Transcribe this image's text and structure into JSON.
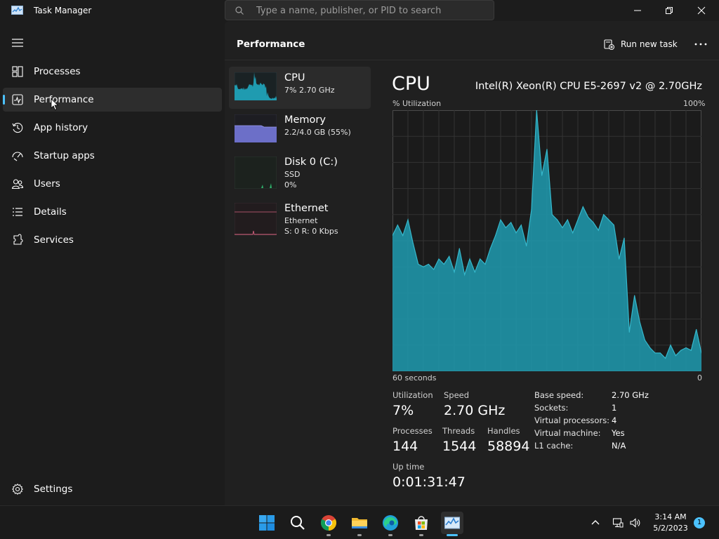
{
  "window": {
    "title": "Task Manager",
    "search_placeholder": "Type a name, publisher, or PID to search"
  },
  "sidebar": {
    "items": [
      {
        "label": "Processes",
        "icon": "processes-grid-icon"
      },
      {
        "label": "Performance",
        "icon": "performance-pulse-icon",
        "active": true
      },
      {
        "label": "App history",
        "icon": "history-clock-icon"
      },
      {
        "label": "Startup apps",
        "icon": "startup-gauge-icon"
      },
      {
        "label": "Users",
        "icon": "users-icon"
      },
      {
        "label": "Details",
        "icon": "details-list-icon"
      },
      {
        "label": "Services",
        "icon": "services-puzzle-icon"
      }
    ],
    "settings_label": "Settings"
  },
  "header": {
    "title": "Performance",
    "run_task_label": "Run new task"
  },
  "devices": [
    {
      "name": "CPU",
      "line1": "7%  2.70 GHz",
      "line2": "",
      "color": "#1f9bb0"
    },
    {
      "name": "Memory",
      "line1": "2.2/4.0 GB (55%)",
      "line2": "",
      "color": "#7b7fd6"
    },
    {
      "name": "Disk 0 (C:)",
      "line1": "SSD",
      "line2": "0%",
      "color": "#2fb06b"
    },
    {
      "name": "Ethernet",
      "line1": "Ethernet",
      "line2": "S: 0  R: 0 Kbps",
      "color": "#d4607e"
    }
  ],
  "detail": {
    "title": "CPU",
    "model": "Intel(R) Xeon(R) CPU E5-2697 v2 @ 2.70GHz",
    "y_label": "% Utilization",
    "y_max_label": "100%",
    "x_left_label": "60 seconds",
    "x_right_label": "0",
    "stats": {
      "utilization_label": "Utilization",
      "utilization": "7%",
      "speed_label": "Speed",
      "speed": "2.70 GHz",
      "processes_label": "Processes",
      "processes": "144",
      "threads_label": "Threads",
      "threads": "1544",
      "handles_label": "Handles",
      "handles": "58894",
      "uptime_label": "Up time",
      "uptime": "0:01:31:47"
    },
    "specs": [
      {
        "label": "Base speed:",
        "value": "2.70 GHz"
      },
      {
        "label": "Sockets:",
        "value": "1"
      },
      {
        "label": "Virtual processors:",
        "value": "4"
      },
      {
        "label": "Virtual machine:",
        "value": "Yes"
      },
      {
        "label": "L1 cache:",
        "value": "N/A"
      }
    ]
  },
  "chart_data": {
    "type": "area",
    "x_seconds_ago": [
      60,
      59,
      58,
      57,
      56,
      55,
      54,
      53,
      52,
      51,
      50,
      49,
      48,
      47,
      46,
      45,
      44,
      43,
      42,
      41,
      40,
      39,
      38,
      37,
      36,
      35,
      34,
      33,
      32,
      31,
      30,
      29,
      28,
      27,
      26,
      25,
      24,
      23,
      22,
      21,
      20,
      19,
      18,
      17,
      16,
      15,
      14,
      13,
      12,
      11,
      10,
      9,
      8,
      7,
      6,
      5,
      4,
      3,
      2,
      1,
      0
    ],
    "values": [
      52,
      56,
      52,
      58,
      49,
      41,
      40,
      41,
      39,
      43,
      41,
      44,
      38,
      47,
      37,
      43,
      38,
      43,
      41,
      47,
      52,
      58,
      55,
      57,
      53,
      56,
      48,
      62,
      100,
      75,
      85,
      60,
      58,
      55,
      58,
      53,
      58,
      63,
      59,
      57,
      54,
      60,
      58,
      56,
      43,
      51,
      15,
      29,
      19,
      12,
      9,
      7,
      7,
      5,
      10,
      6,
      8,
      9,
      8,
      16,
      7
    ],
    "ylim": [
      0,
      100
    ],
    "xlabel": "60 seconds",
    "ylabel": "% Utilization",
    "grid": true,
    "color": "#1f9bb0"
  },
  "taskbar": {
    "apps": [
      "windows-start-icon",
      "search-icon",
      "chrome-icon",
      "file-explorer-icon",
      "edge-icon",
      "microsoft-store-icon",
      "task-manager-icon"
    ],
    "time": "3:14 AM",
    "date": "5/2/2023",
    "notification_count": "1"
  }
}
